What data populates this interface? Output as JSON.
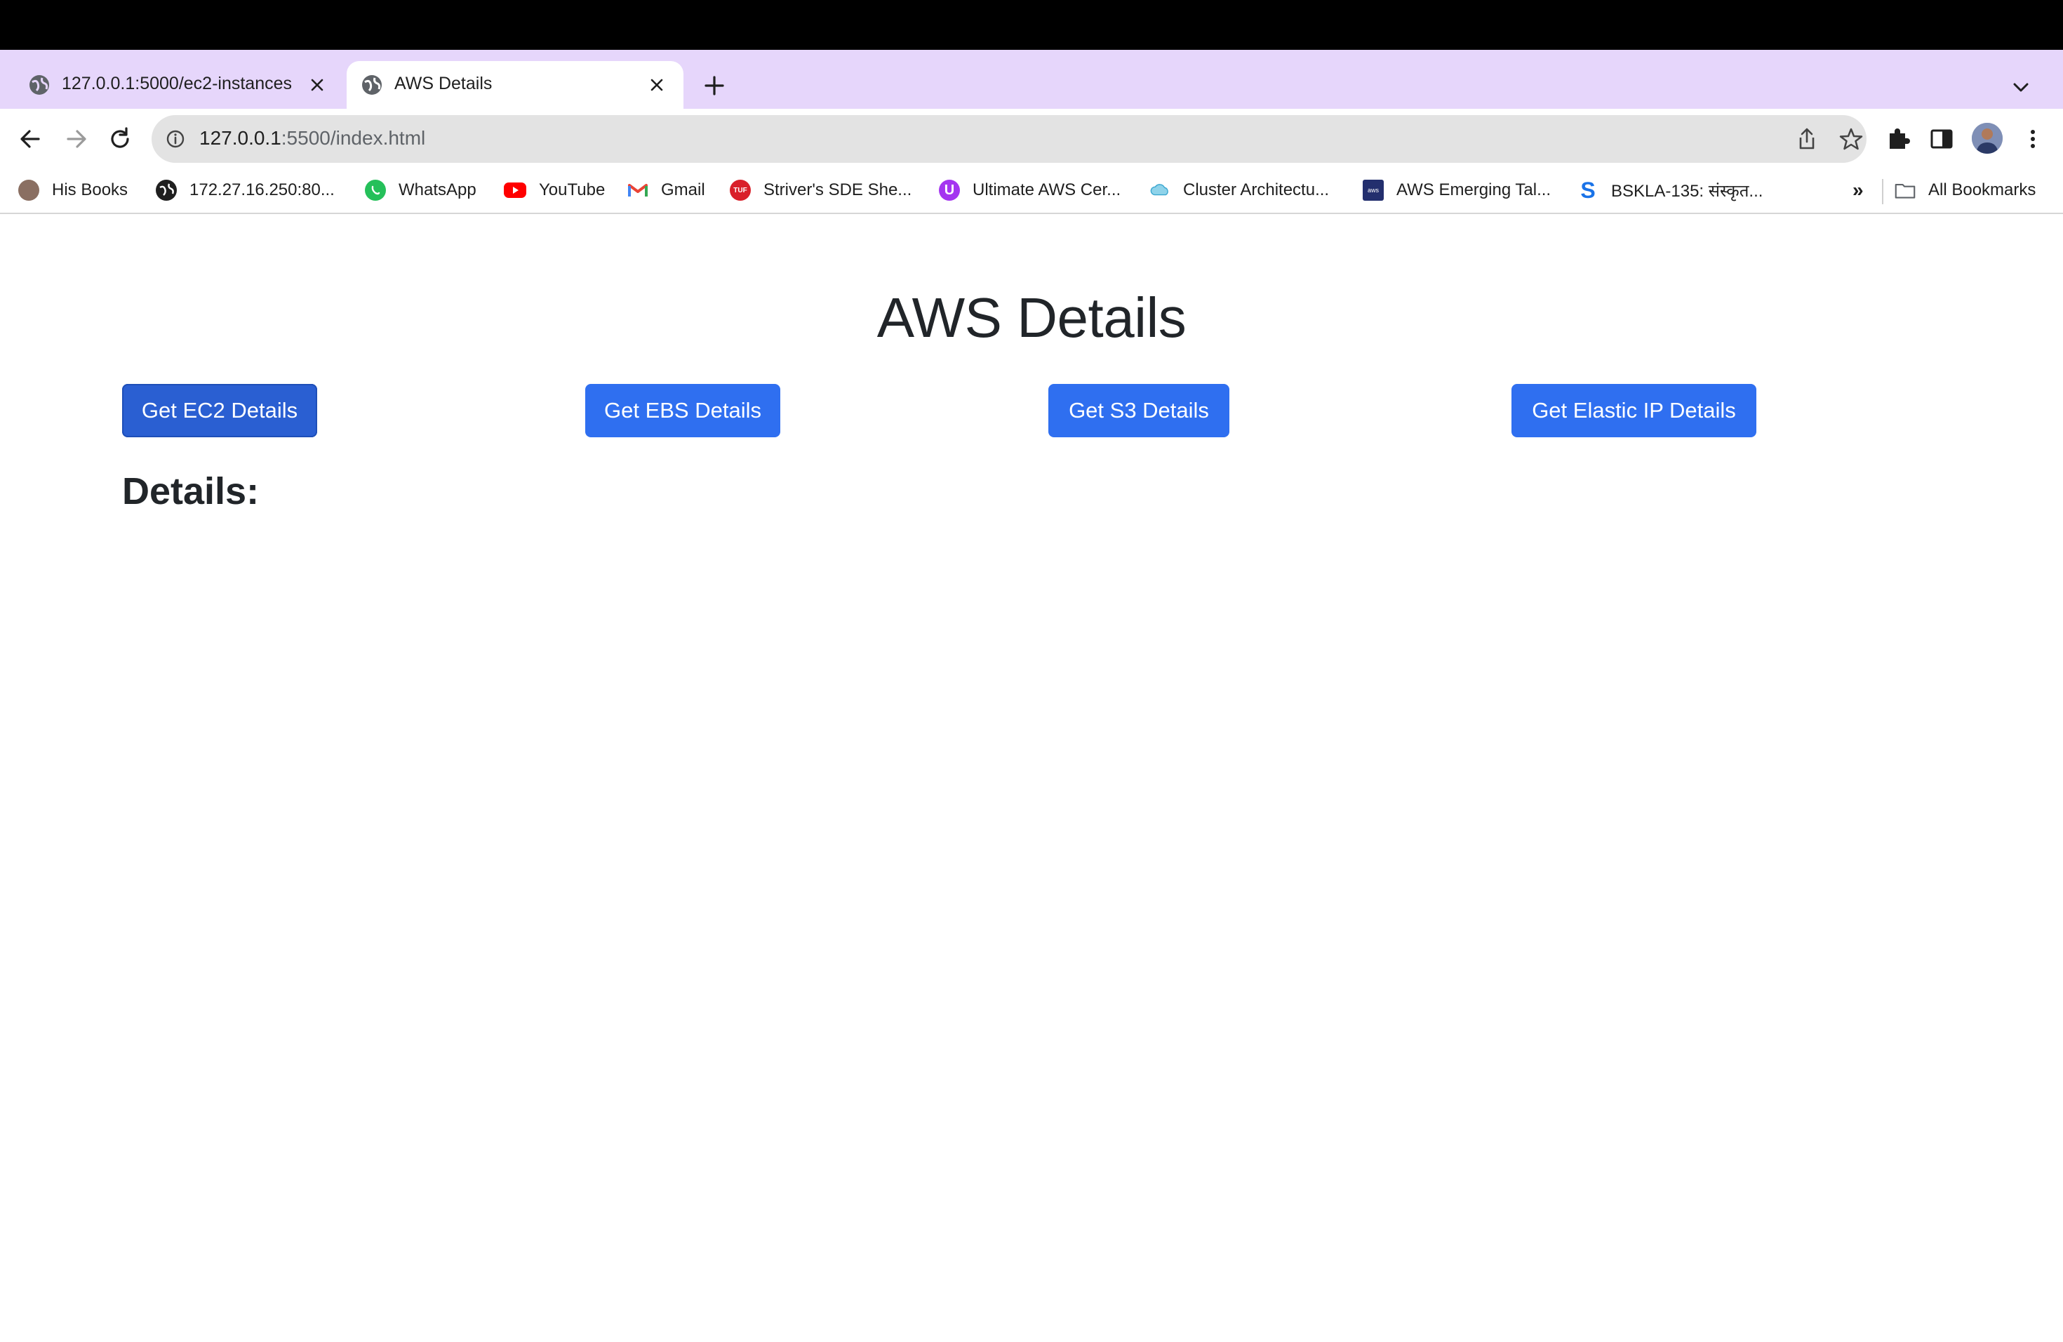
{
  "browser": {
    "tabs": [
      {
        "title": "127.0.0.1:5000/ec2-instances",
        "active": false
      },
      {
        "title": "AWS Details",
        "active": true
      }
    ],
    "url_host": "127.0.0.1",
    "url_rest": ":5500/index.html",
    "bookmarks": [
      {
        "label": "His Books",
        "icon": "avatar-icon"
      },
      {
        "label": "172.27.16.250:80...",
        "icon": "globe-icon"
      },
      {
        "label": "WhatsApp",
        "icon": "whatsapp-icon"
      },
      {
        "label": "YouTube",
        "icon": "youtube-icon"
      },
      {
        "label": "Gmail",
        "icon": "gmail-icon"
      },
      {
        "label": "Striver's SDE She...",
        "icon": "tuf-icon"
      },
      {
        "label": "Ultimate AWS Cer...",
        "icon": "udemy-icon"
      },
      {
        "label": "Cluster Architectu...",
        "icon": "cloud-icon"
      },
      {
        "label": "AWS Emerging Tal...",
        "icon": "aws-icon"
      },
      {
        "label": "BSKLA-135: संस्कृत...",
        "icon": "s-icon"
      }
    ],
    "more_bookmarks": "»",
    "all_bookmarks": "All Bookmarks"
  },
  "page": {
    "title": "AWS Details",
    "buttons": {
      "ec2": "Get EC2 Details",
      "ebs": "Get EBS Details",
      "s3": "Get S3 Details",
      "eip": "Get Elastic IP Details"
    },
    "details_heading": "Details:"
  },
  "colors": {
    "tabstrip": "#e6d6fb",
    "button": "#2f6ff0",
    "text": "#212529"
  }
}
